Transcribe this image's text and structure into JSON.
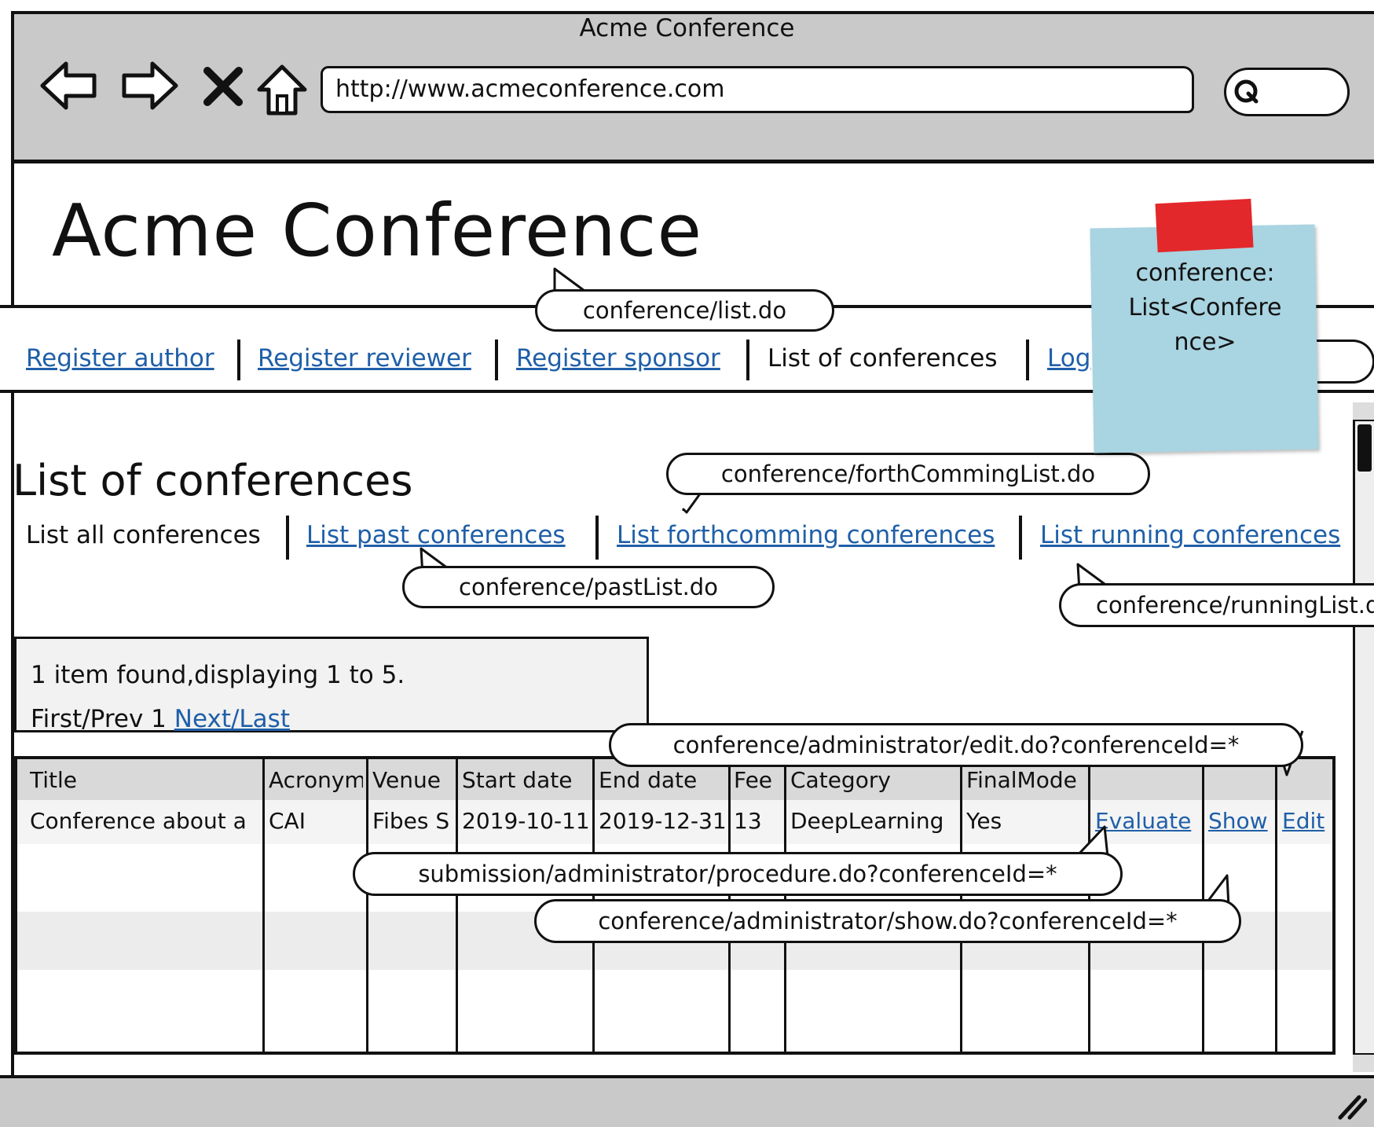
{
  "browser": {
    "window_title": "Acme Conference",
    "url": "http://www.acmeconference.com"
  },
  "site": {
    "title": "Acme Conference"
  },
  "menu": [
    {
      "label": "Register author",
      "link": true
    },
    {
      "label": "Register reviewer",
      "link": true
    },
    {
      "label": "Register sponsor",
      "link": true
    },
    {
      "label": "List of conferences",
      "link": false
    },
    {
      "label": "Log",
      "link": true
    }
  ],
  "page": {
    "heading": "List of conferences",
    "sublinks": [
      {
        "label": "List all conferences",
        "link": false
      },
      {
        "label": "List past conferences",
        "link": true
      },
      {
        "label": "List forthcomming conferences",
        "link": true
      },
      {
        "label": "List running conferences",
        "link": true
      }
    ]
  },
  "pager": {
    "summary": "1 item found,displaying 1 to 5.",
    "prefix": "First/Prev 1 ",
    "next_last": "Next/Last"
  },
  "table": {
    "headers": [
      "Title",
      "Acronym",
      "Venue",
      "Start date",
      "End date",
      "Fee",
      "Category",
      "FinalMode",
      "",
      "",
      ""
    ],
    "rows": [
      {
        "title": "Conference about a",
        "acronym": "CAI",
        "venue": "Fibes S",
        "start_date": "2019-10-11",
        "end_date": "2019-12-31",
        "fee": "13",
        "category": "DeepLearning",
        "final_mode": "Yes",
        "evaluate": "Evaluate",
        "show": "Show",
        "edit": "Edit"
      }
    ]
  },
  "annotations": {
    "list": "conference/list.do",
    "forthcoming": "conference/forthCommingList.do",
    "past": "conference/pastList.do",
    "running": "conference/runningList.do",
    "edit": "conference/administrator/edit.do?conferenceId=*",
    "procedure": "submission/administrator/procedure.do?conferenceId=*",
    "show": "conference/administrator/show.do?conferenceId=*"
  },
  "sticky_note": {
    "line1": "conference:",
    "line2": "List<Confere",
    "line3": "nce>"
  },
  "colors": {
    "chrome": "#c9c9c9",
    "link": "#1f5fa8",
    "sticky": "#a9d4e1",
    "tape": "#e3282b"
  }
}
